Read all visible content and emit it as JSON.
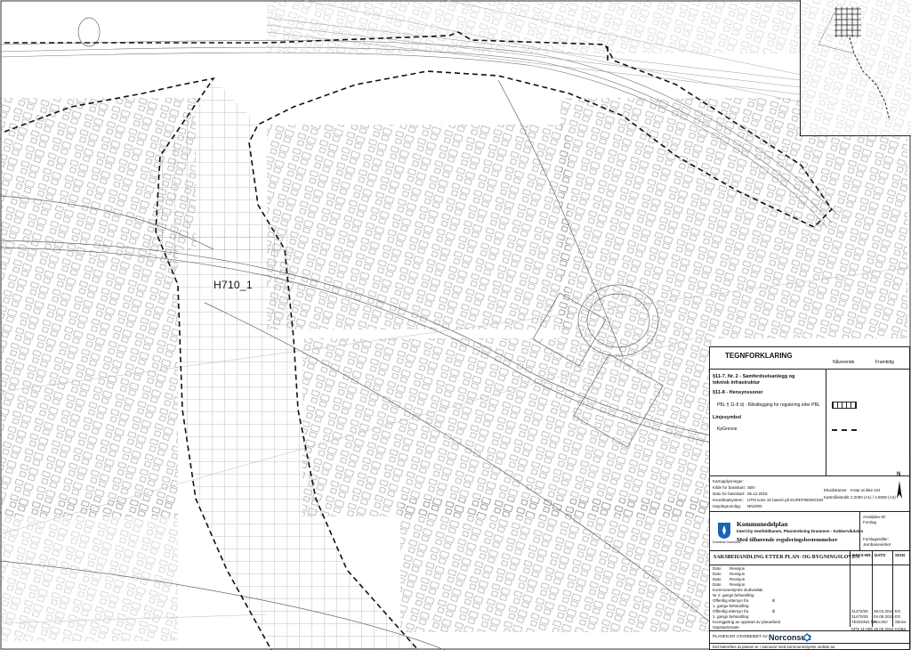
{
  "map": {
    "area_label": "H710_1"
  },
  "legend": {
    "title": "TEGNFORKLARING",
    "col_existing": "Nåverende",
    "col_future": "Framtidig",
    "section_a": "§11-7. Nr. 2 - Samferdselsanlegg og",
    "section_a2": "teknisk infrastruktur",
    "section_b": "§11-8 - Hensynssoner",
    "item_b1": "PBL § 11-8 d) - Båndlegging for regulering etter PBL",
    "section_c": "Linjesymbol",
    "item_c1": "KpGrense"
  },
  "meta": {
    "header": "Kartopplysninger:",
    "rows": [
      {
        "k": "Kilde for basiskart:",
        "v": "SBV"
      },
      {
        "k": "Dato for basiskart:",
        "v": "06.12.2016"
      },
      {
        "k": "Koordinatsystem:",
        "v": "UTM sone 32 basert på EUREF89/WGS84"
      },
      {
        "k": "Høydegrunnlag:",
        "v": "NN2000"
      }
    ],
    "equidistance_label": "Ekvidistanse:",
    "equidistance_value": "Kotar at ikke vist",
    "scale_label": "Kartmålestokk:",
    "scale_value": "1:2000 (A1) / 1:5000 (A3)",
    "north": "N"
  },
  "plan": {
    "title": "Kommunedelplan",
    "subtitle": "InterCity Vestfoldbanen, Planstrekning Drammen - Kobbervikdalen",
    "subtitle2": "Med tilhørende reguleringsbestemmelser",
    "municipality": "Drammen kommune",
    "plan_id_label": "Arealplan-ID:",
    "plan_id_status": "Forslag",
    "signature_label": "Forslagsstiller:",
    "signature_value": "Jernbaneverket"
  },
  "case": {
    "title": "SAKSBEHANDLING ETTER PLAN- OG BYGNINGSLOVEN",
    "col_sak": "SAKS-NR.",
    "col_dato": "DATO",
    "col_sign": "SIGN",
    "rows": [
      {
        "k": "Dato",
        "v": "Revisjon"
      },
      {
        "k": "Dato",
        "v": "Revisjon"
      },
      {
        "k": "Dato",
        "v": "Revisjon"
      },
      {
        "k": "Dato",
        "v": "Revisjon"
      },
      {
        "k": "Kommunestyrets sluttvedtak",
        "v": ""
      },
      {
        "k": "Nr 2. gangs behandling",
        "v": ""
      },
      {
        "k": "Offentlig ettersyn fra",
        "v": "til"
      },
      {
        "k": "1. gangs behandling",
        "v": ""
      },
      {
        "k": "Offentlig ettersyn fra",
        "v": "til"
      },
      {
        "k": "1. gangs behandling",
        "v": ""
      },
      {
        "k": "Kunngjøring av oppstart av planarbeid",
        "v": ""
      },
      {
        "k": "Oppstartsmøte",
        "v": ""
      }
    ],
    "right_rows": [
      {
        "sak": "31470/25",
        "dato": "29.04.2015",
        "sign": "EG"
      },
      {
        "sak": "31470/25",
        "dato": "04.09.2015",
        "sign": "EG"
      },
      {
        "sak": "TEGNING NR.",
        "dato": "Rev.NO",
        "sign": "Skrive"
      },
      {
        "sak": "KPS 11-008",
        "dato": "18.03.2016",
        "sign": "KOBa"
      }
    ],
    "prepared_by": "PLANEN ER UTARBEIDET AV:",
    "consultant": "Norconsult",
    "footer": "Det bekreftes at planen er i samsvar med kommunestyrets vedtak av:"
  }
}
